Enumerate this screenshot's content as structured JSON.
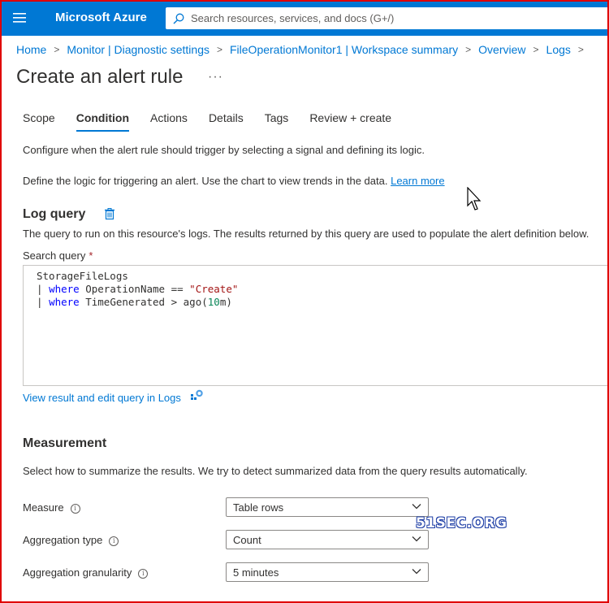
{
  "topbar": {
    "brand": "Microsoft Azure",
    "search_placeholder": "Search resources, services, and docs (G+/)",
    "bg_color": "#0078d4"
  },
  "breadcrumb": [
    "Home",
    "Monitor | Diagnostic settings",
    "FileOperationMonitor1 | Workspace summary",
    "Overview",
    "Logs"
  ],
  "page": {
    "title": "Create an alert rule",
    "more": "···"
  },
  "tabs": [
    {
      "label": "Scope",
      "active": false
    },
    {
      "label": "Condition",
      "active": true
    },
    {
      "label": "Actions",
      "active": false
    },
    {
      "label": "Details",
      "active": false
    },
    {
      "label": "Tags",
      "active": false
    },
    {
      "label": "Review + create",
      "active": false
    }
  ],
  "condition": {
    "intro": "Configure when the alert rule should trigger by selecting a signal and defining its logic.",
    "define_text": "Define the logic for triggering an alert. Use the chart to view trends in the data.",
    "learn_more": "Learn more"
  },
  "log_query": {
    "title": "Log query",
    "description": "The query to run on this resource's logs. The results returned by this query are used to populate the alert definition below.",
    "search_label": "Search query",
    "required_mark": "*",
    "lines": {
      "l1": "StorageFileLogs",
      "l2_pipe": "| ",
      "l2_kw": "where",
      "l2_mid": " OperationName == ",
      "l2_str": "\"Create\"",
      "l3_pipe": "| ",
      "l3_kw": "where",
      "l3_mid": " TimeGenerated > ago(",
      "l3_num": "10",
      "l3_end": "m)"
    },
    "view_link": "View result and edit query in Logs"
  },
  "measurement": {
    "title": "Measurement",
    "description": "Select how to summarize the results. We try to detect summarized data from the query results automatically.",
    "measure_label": "Measure",
    "measure_value": "Table rows",
    "aggregation_type_label": "Aggregation type",
    "aggregation_type_value": "Count",
    "aggregation_granularity_label": "Aggregation granularity",
    "aggregation_granularity_value": "5 minutes"
  },
  "watermark": "51SEC.ORG"
}
